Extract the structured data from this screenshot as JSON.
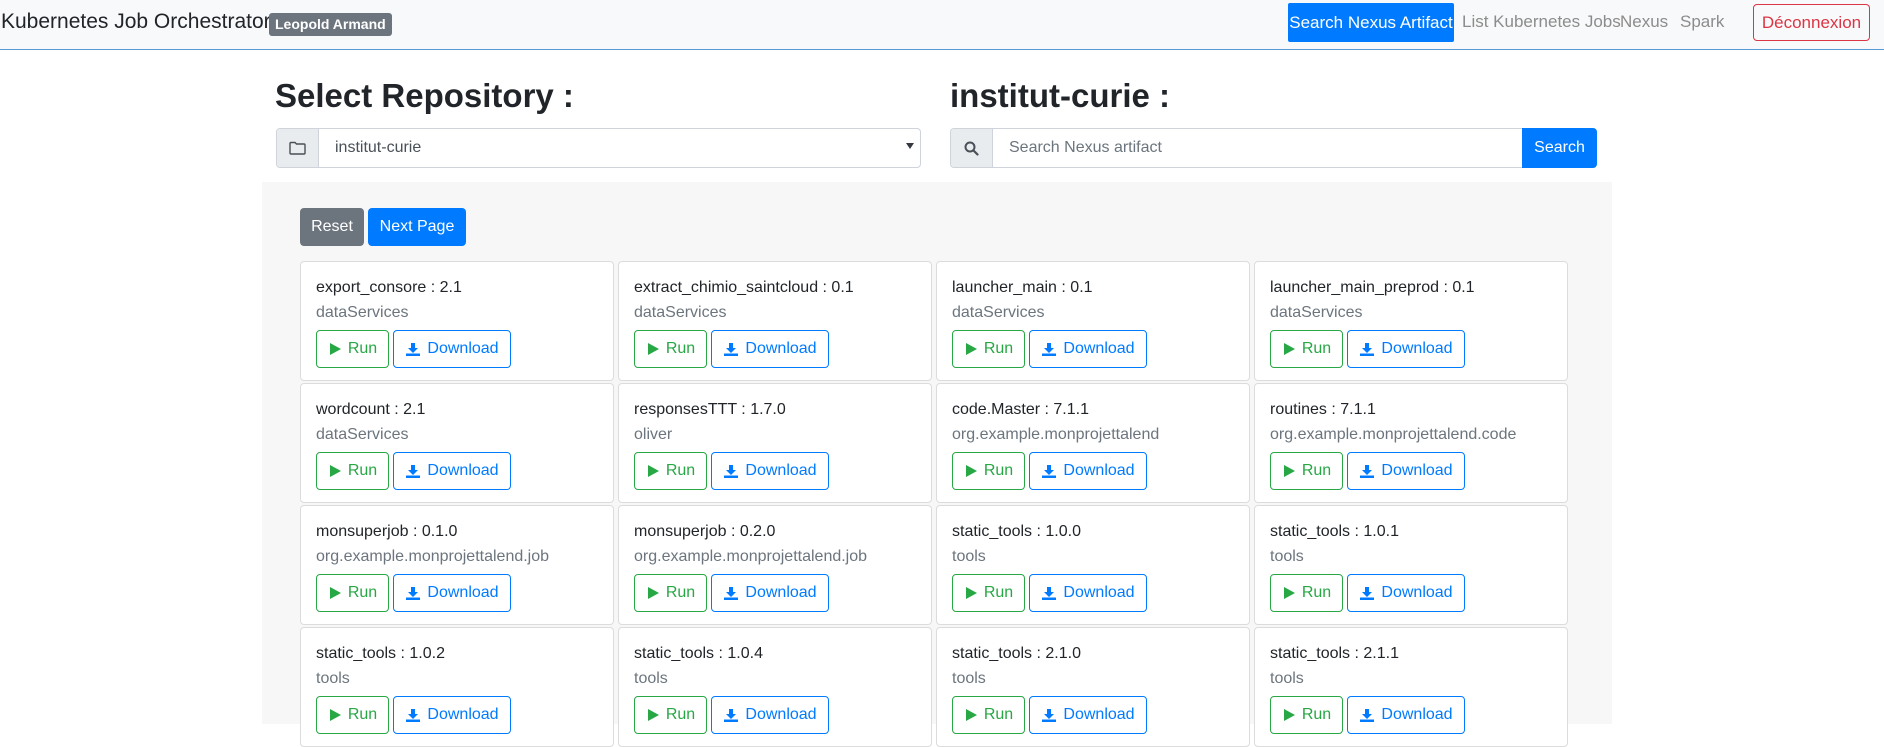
{
  "navbar": {
    "brand": "Kubernetes Job Orchestrator",
    "user": "Leopold Armand",
    "links": {
      "search_artifact": "Search Nexus Artifact",
      "list_jobs": "List Kubernetes Jobs",
      "nexus": "Nexus",
      "spark": "Spark"
    },
    "logout": "Déconnexion"
  },
  "repository": {
    "heading": "Select Repository :",
    "selected": "institut-curie"
  },
  "search": {
    "heading": "institut-curie :",
    "placeholder": "Search Nexus artifact",
    "button": "Search"
  },
  "actions": {
    "reset": "Reset",
    "next_page": "Next Page"
  },
  "card_buttons": {
    "run": "Run",
    "download": "Download"
  },
  "artifacts": [
    {
      "title": "export_consore : 2.1",
      "group": "dataServices"
    },
    {
      "title": "extract_chimio_saintcloud : 0.1",
      "group": "dataServices"
    },
    {
      "title": "launcher_main : 0.1",
      "group": "dataServices"
    },
    {
      "title": "launcher_main_preprod : 0.1",
      "group": "dataServices"
    },
    {
      "title": "wordcount : 2.1",
      "group": "dataServices"
    },
    {
      "title": "responsesTTT : 1.7.0",
      "group": "oliver"
    },
    {
      "title": "code.Master : 7.1.1",
      "group": "org.example.monprojettalend"
    },
    {
      "title": "routines : 7.1.1",
      "group": "org.example.monprojettalend.code"
    },
    {
      "title": "monsuperjob : 0.1.0",
      "group": "org.example.monprojettalend.job"
    },
    {
      "title": "monsuperjob : 0.2.0",
      "group": "org.example.monprojettalend.job"
    },
    {
      "title": "static_tools : 1.0.0",
      "group": "tools"
    },
    {
      "title": "static_tools : 1.0.1",
      "group": "tools"
    },
    {
      "title": "static_tools : 1.0.2",
      "group": "tools"
    },
    {
      "title": "static_tools : 1.0.4",
      "group": "tools"
    },
    {
      "title": "static_tools : 2.1.0",
      "group": "tools"
    },
    {
      "title": "static_tools : 2.1.1",
      "group": "tools"
    }
  ],
  "colors": {
    "primary": "#007bff",
    "success": "#28a745",
    "danger": "#dc3545",
    "secondary": "#6c757d"
  },
  "icons": {
    "repository": "folder-icon",
    "search": "search-icon",
    "run": "play-icon",
    "download": "download-icon"
  }
}
